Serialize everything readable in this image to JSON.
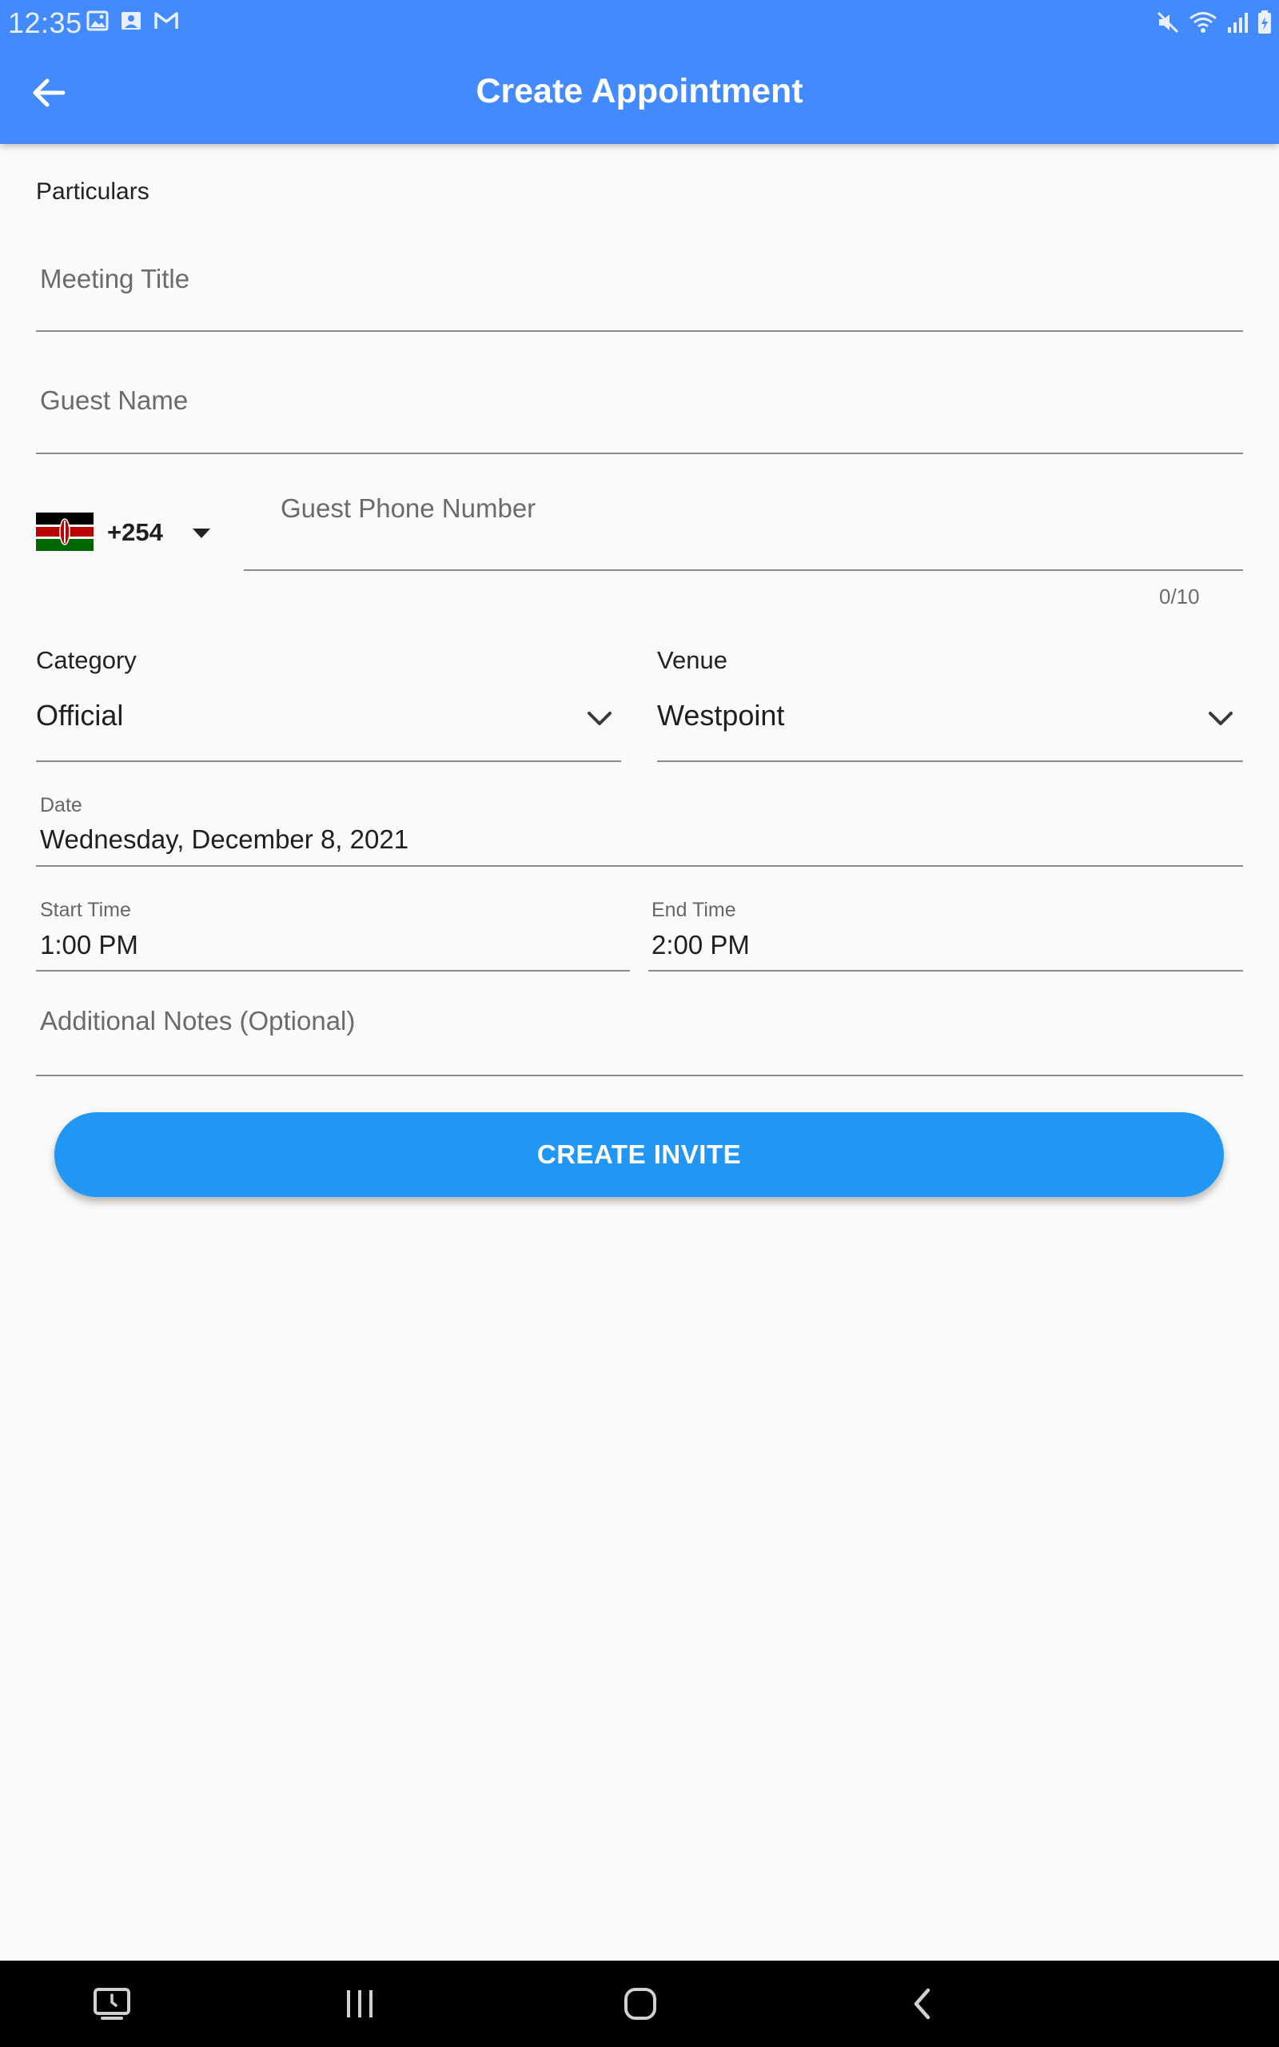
{
  "status_bar": {
    "time": "12:35",
    "left_icons": [
      "image-icon",
      "photo-upload-icon",
      "gmail-icon"
    ],
    "right_icons": [
      "mute-icon",
      "wifi-icon",
      "signal-icon",
      "battery-icon"
    ]
  },
  "app_bar": {
    "title": "Create Appointment",
    "back_icon": "arrow-left-icon",
    "color": "#448aff"
  },
  "form": {
    "section_label": "Particulars",
    "meeting_title": {
      "placeholder": "Meeting Title",
      "value": ""
    },
    "guest_name": {
      "placeholder": "Guest Name",
      "value": ""
    },
    "phone": {
      "country_flag": "kenya-flag-icon",
      "dial_code": "+254",
      "placeholder": "Guest Phone Number",
      "value": "",
      "counter": "0/10"
    },
    "category": {
      "label": "Category",
      "value": "Official"
    },
    "venue": {
      "label": "Venue",
      "value": "Westpoint"
    },
    "date": {
      "label": "Date",
      "value": "Wednesday, December 8, 2021"
    },
    "start_time": {
      "label": "Start Time",
      "value": "1:00 PM"
    },
    "end_time": {
      "label": "End Time",
      "value": "2:00 PM"
    },
    "notes": {
      "placeholder": "Additional Notes (Optional)",
      "value": ""
    }
  },
  "cta": {
    "label": "CREATE INVITE",
    "color": "#2196f3"
  },
  "nav_bar": {
    "buttons": [
      "screen-recorder-icon",
      "recent-apps-icon",
      "home-icon",
      "back-icon"
    ]
  }
}
